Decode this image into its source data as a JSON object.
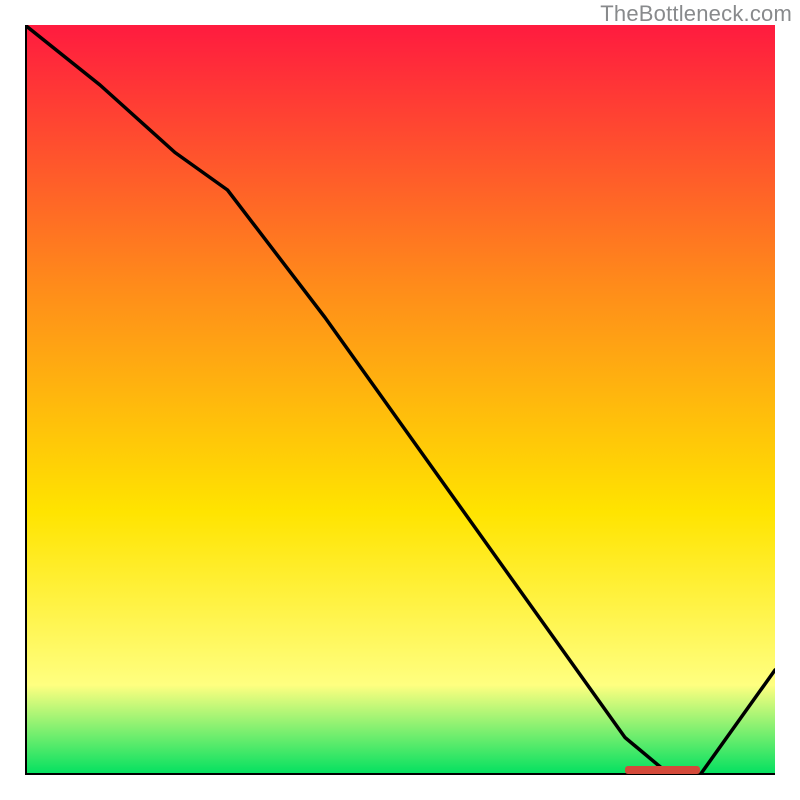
{
  "watermark": "TheBottleneck.com",
  "colors": {
    "gradient_top": "#ff1b3f",
    "gradient_mid1": "#ff8c1a",
    "gradient_mid2": "#ffe400",
    "gradient_low": "#ffff80",
    "gradient_bottom": "#00e060",
    "axis": "#000000",
    "curve": "#000000",
    "marker": "#d44a3a"
  },
  "chart_data": {
    "type": "line",
    "title": "",
    "xlabel": "",
    "ylabel": "",
    "xlim": [
      0,
      100
    ],
    "ylim": [
      0,
      100
    ],
    "x": [
      0,
      10,
      20,
      27,
      40,
      50,
      60,
      70,
      80,
      86,
      90,
      100
    ],
    "values": [
      100,
      92,
      83,
      78,
      61,
      47,
      33,
      19,
      5,
      0,
      0,
      14
    ],
    "marker_segment": {
      "x0": 80,
      "x1": 90,
      "y": 0
    }
  }
}
